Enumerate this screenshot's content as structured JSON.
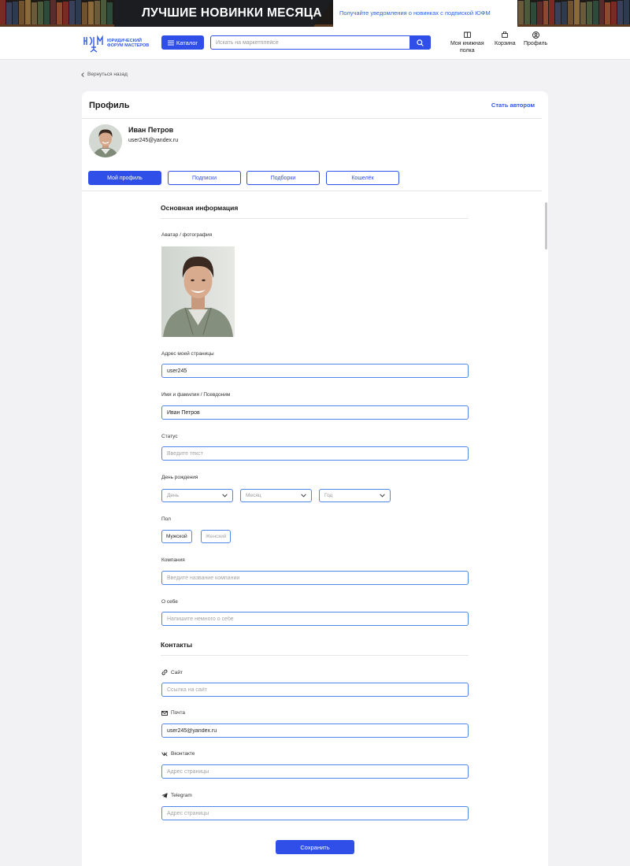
{
  "banner": {
    "title": "ЛУЧШИЕ НОВИНКИ МЕСЯЦА",
    "note": "Получайте уведомления о новинках с подпиской ЮФМ"
  },
  "header": {
    "logo_line1": "ЮРИДИЧЕСКИЙ",
    "logo_line2": "ФОРУМ МАСТЕРОВ",
    "catalog_label": "Каталог",
    "search_placeholder": "Искать на маркетплейсе",
    "nav": {
      "shelf_line1": "Моя книжная",
      "shelf_line2": "полка",
      "cart": "Корзина",
      "profile": "Профиль"
    }
  },
  "back_label": "Вернуться назад",
  "profile": {
    "title": "Профиль",
    "become_author": "Стать автором",
    "name": "Иван Петров",
    "email": "user245@yandex.ru",
    "tabs": [
      "Мой профиль",
      "Подписки",
      "Подборки",
      "Кошелёк"
    ],
    "active_tab": "Мой профиль"
  },
  "main_info": {
    "section_title": "Основная информация",
    "avatar_label": "Аватар / фотография",
    "page_address_label": "Адрес моей страницы",
    "page_address_value": "user245",
    "name_label": "Имя и фамилия / Псевдоним",
    "name_value": "Иван Петров",
    "status_label": "Статус",
    "status_placeholder": "Введите текст",
    "birthday_label": "День рождения",
    "day_placeholder": "День",
    "month_placeholder": "Месяц",
    "year_placeholder": "Год",
    "gender_label": "Пол",
    "gender_male": "Мужской",
    "gender_female": "Женский",
    "selected_gender": "Мужской",
    "company_label": "Компания",
    "company_placeholder": "Введите название компании",
    "about_label": "О себе",
    "about_placeholder": "Напишите немного о себе"
  },
  "contacts": {
    "section_title": "Контакты",
    "site_label": "Сайт",
    "site_placeholder": "Ссылка на сайт",
    "mail_label": "Почта",
    "mail_value": "user245@yandex.ru",
    "vk_label": "Вконтакте",
    "vk_placeholder": "Адрес страницы",
    "telegram_label": "Telegram",
    "telegram_placeholder": "Адрес страницы"
  },
  "save_label": "Сохранить",
  "colors": {
    "accent": "#2f4fe8",
    "field_border": "#4f86e8",
    "banner_bg": "#1b1d21",
    "page_bg": "#f2f2f4"
  }
}
